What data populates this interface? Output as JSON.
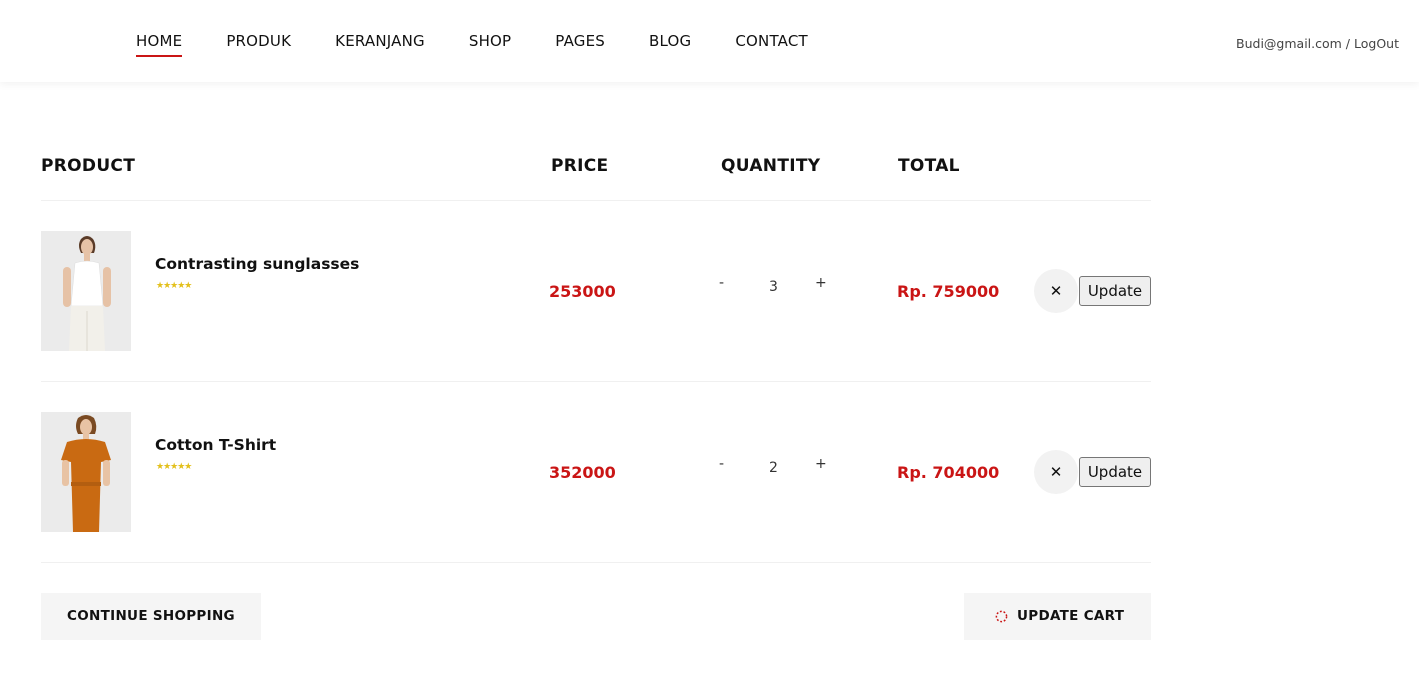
{
  "nav": {
    "items": [
      {
        "label": "HOME",
        "active": true
      },
      {
        "label": "PRODUK",
        "active": false
      },
      {
        "label": "KERANJANG",
        "active": false
      },
      {
        "label": "SHOP",
        "active": false
      },
      {
        "label": "PAGES",
        "active": false
      },
      {
        "label": "BLOG",
        "active": false
      },
      {
        "label": "CONTACT",
        "active": false
      }
    ],
    "user_email": "Budi@gmail.com",
    "separator": " / ",
    "logout_label": "LogOut"
  },
  "table": {
    "headers": {
      "product": "PRODUCT",
      "price": "PRICE",
      "quantity": "QUANTITY",
      "total": "TOTAL"
    }
  },
  "cart": {
    "items": [
      {
        "name": "Contrasting sunglasses",
        "rating": 5,
        "stars": "★★★★★",
        "price": "253000",
        "quantity": "3",
        "total": "Rp. 759000",
        "image_icon": "model-white-dress-photo"
      },
      {
        "name": "Cotton T-Shirt",
        "rating": 5,
        "stars": "★★★★★",
        "price": "352000",
        "quantity": "2",
        "total": "Rp. 704000",
        "image_icon": "model-orange-dress-photo"
      }
    ],
    "qty_minus": "-",
    "qty_plus": "+",
    "remove_glyph": "✕",
    "update_label": "Update"
  },
  "actions": {
    "continue_label": "CONTINUE SHOPPING",
    "update_cart_label": "UPDATE CART",
    "update_cart_icon": "spinner-icon"
  },
  "colors": {
    "accent": "#ca1515",
    "star": "#e3c01c",
    "button_bg": "#f5f5f5"
  }
}
